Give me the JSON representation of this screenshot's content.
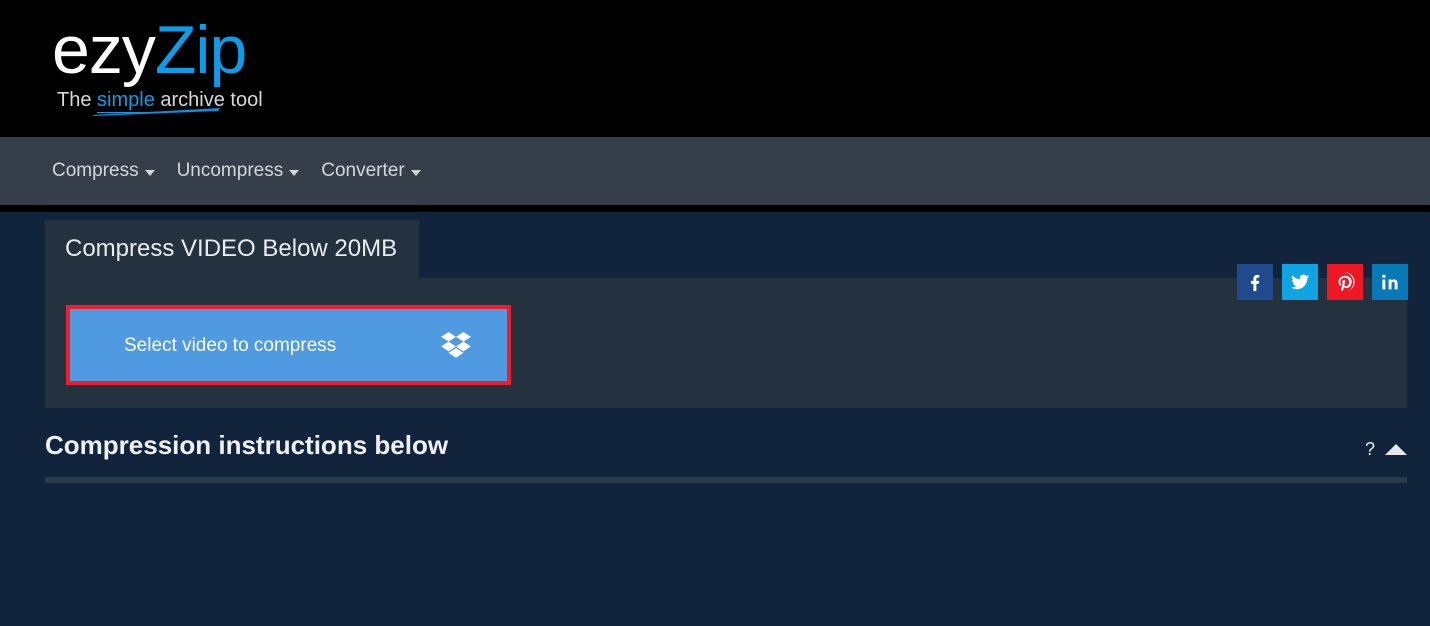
{
  "header": {
    "logo_primary": "ezy",
    "logo_accent": "Zip",
    "tagline_prefix": "The ",
    "tagline_accent": "simple",
    "tagline_suffix": " archive tool",
    "accent_color": "#0b9de8"
  },
  "nav": {
    "items": [
      {
        "label": "Compress",
        "icon": "chevron-down-icon"
      },
      {
        "label": "Uncompress",
        "icon": "chevron-down-icon"
      },
      {
        "label": "Converter",
        "icon": "chevron-down-icon"
      }
    ]
  },
  "social": {
    "items": [
      {
        "name": "facebook",
        "label": "f",
        "color": "#1f4b8e"
      },
      {
        "name": "twitter",
        "label": "",
        "color": "#10a5e2"
      },
      {
        "name": "pinterest",
        "label": "",
        "color": "#f01725"
      },
      {
        "name": "linkedin",
        "label": "in",
        "color": "#0779b7"
      }
    ]
  },
  "card": {
    "tab_label": "Compress VIDEO Below 20MB",
    "select_button_label": "Select video to compress",
    "select_button_icon": "dropbox-icon",
    "select_button_color": "#4f9ae0",
    "highlight_color": "#f01e2c"
  },
  "instructions": {
    "title": "Compression instructions below",
    "help_label": "?",
    "collapse_icon": "caret-up-icon"
  }
}
